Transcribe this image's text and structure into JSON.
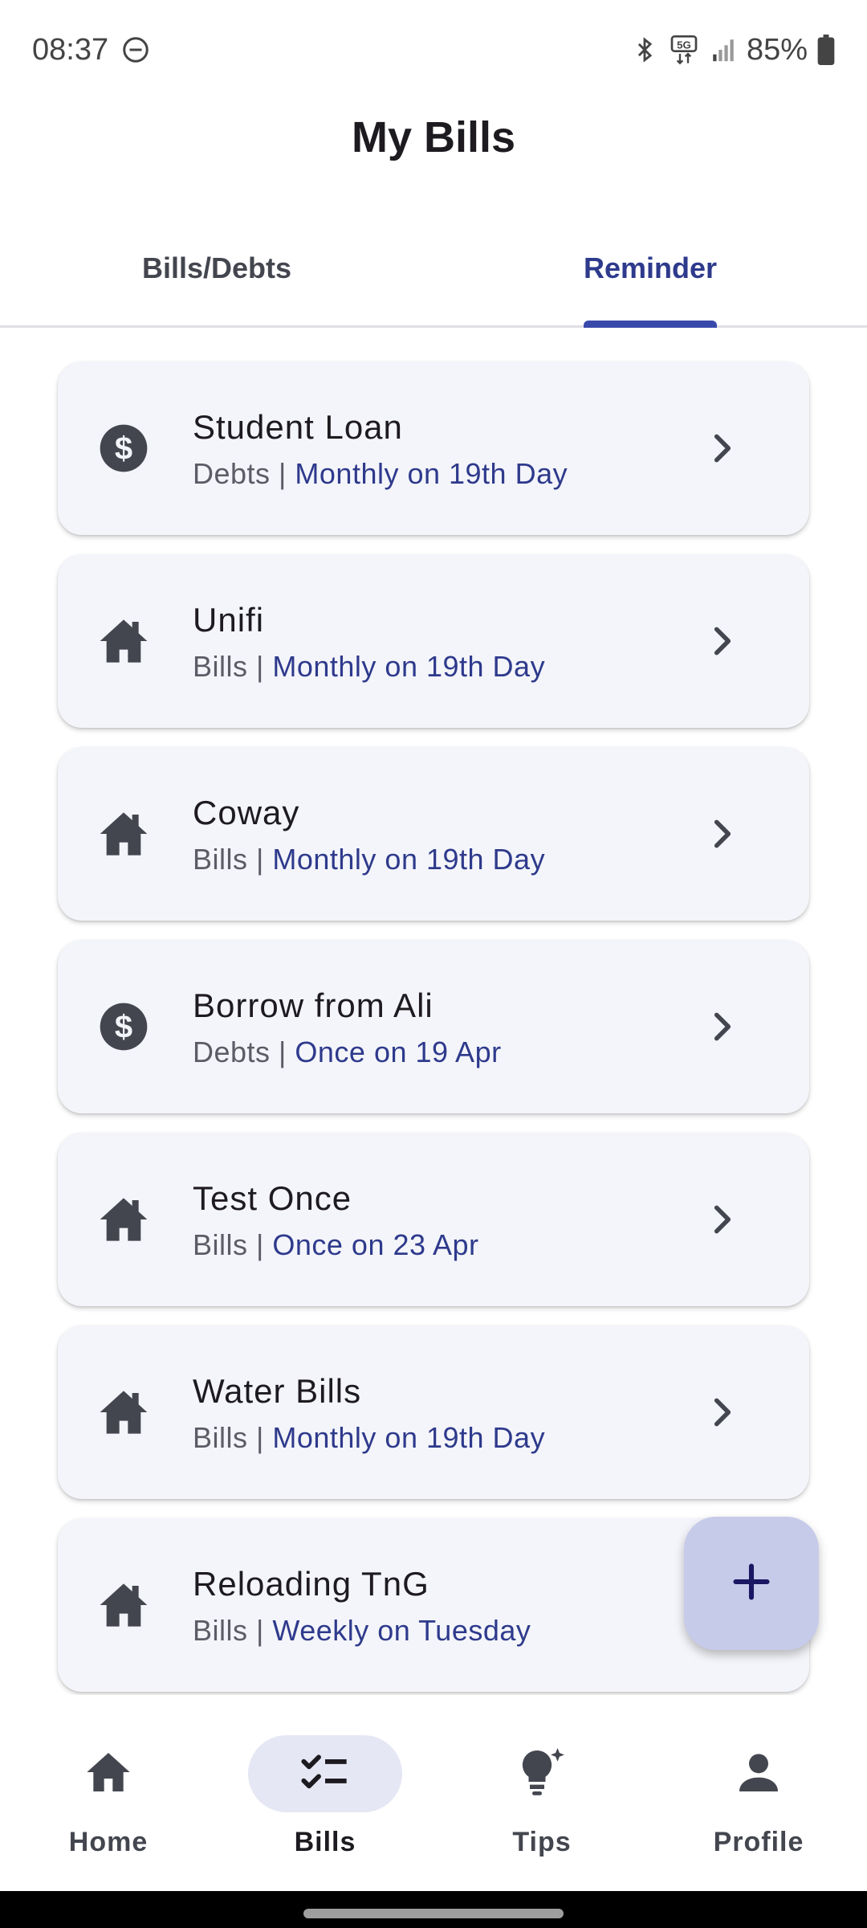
{
  "status_bar": {
    "time": "08:37",
    "battery": "85%",
    "network": "5G",
    "icons": [
      "do-not-disturb-icon",
      "bluetooth-icon",
      "5g-icon",
      "signal-icon",
      "battery-icon"
    ]
  },
  "app_bar": {
    "title": "My Bills"
  },
  "tabs": [
    {
      "label": "Bills/Debts",
      "active": false
    },
    {
      "label": "Reminder",
      "active": true
    }
  ],
  "reminders": [
    {
      "title": "Student Loan",
      "type": "Debts",
      "separator": " | ",
      "schedule": "Monthly on 19th Day",
      "icon": "dollar-icon"
    },
    {
      "title": "Unifi",
      "type": "Bills",
      "separator": " | ",
      "schedule": "Monthly on 19th Day",
      "icon": "house-icon"
    },
    {
      "title": "Coway",
      "type": "Bills",
      "separator": " | ",
      "schedule": "Monthly on 19th Day",
      "icon": "house-icon"
    },
    {
      "title": "Borrow from Ali",
      "type": "Debts",
      "separator": " | ",
      "schedule": "Once on 19 Apr",
      "icon": "dollar-icon"
    },
    {
      "title": "Test Once",
      "type": "Bills",
      "separator": " | ",
      "schedule": "Once on 23 Apr",
      "icon": "house-icon"
    },
    {
      "title": "Water Bills",
      "type": "Bills",
      "separator": " | ",
      "schedule": "Monthly on 19th Day",
      "icon": "house-icon"
    },
    {
      "title": "Reloading TnG",
      "type": "Bills",
      "separator": " | ",
      "schedule": "Weekly on Tuesday",
      "icon": "house-icon"
    }
  ],
  "fab": {
    "icon": "plus-icon"
  },
  "bottom_nav": [
    {
      "label": "Home",
      "icon": "home-icon",
      "active": false
    },
    {
      "label": "Bills",
      "icon": "checklist-icon",
      "active": true
    },
    {
      "label": "Tips",
      "icon": "lightbulb-icon",
      "active": false
    },
    {
      "label": "Profile",
      "icon": "person-icon",
      "active": false
    }
  ],
  "colors": {
    "accent": "#2e3a8c",
    "indicator": "#3949ab",
    "card_bg": "#f4f5fa",
    "fab_bg": "#c7cbea",
    "nav_active_pill": "#e6e7f4"
  }
}
